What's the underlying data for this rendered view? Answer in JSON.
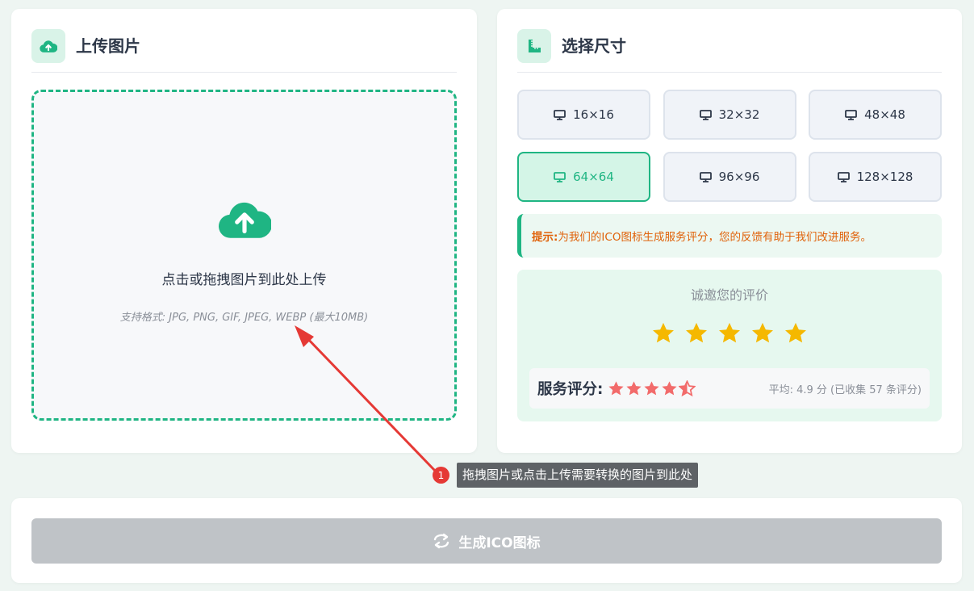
{
  "upload": {
    "title": "上传图片",
    "dropzone_text": "点击或拖拽图片到此处上传",
    "formats_text": "支持格式: JPG, PNG, GIF, JPEG, WEBP (最大10MB)"
  },
  "sizes": {
    "title": "选择尺寸",
    "options": [
      {
        "label": "16×16",
        "selected": false
      },
      {
        "label": "32×32",
        "selected": false
      },
      {
        "label": "48×48",
        "selected": false
      },
      {
        "label": "64×64",
        "selected": true
      },
      {
        "label": "96×96",
        "selected": false
      },
      {
        "label": "128×128",
        "selected": false
      }
    ]
  },
  "tip": {
    "prefix": "提示:",
    "text": "为我们的ICO图标生成服务评分，您的反馈有助于我们改进服务。"
  },
  "rating": {
    "invite": "诚邀您的评价",
    "star_count": 5,
    "score_label": "服务评分:",
    "average_stars": 4.5,
    "summary": "平均: 4.9 分 (已收集 57 条评分)"
  },
  "action": {
    "generate_label": "生成ICO图标"
  },
  "annotation": {
    "number": "1",
    "text": "拖拽图片或点击上传需要转换的图片到此处"
  },
  "colors": {
    "accent": "#1fb583",
    "tip_text": "#e0620a",
    "star_yellow": "#f5b800",
    "star_red": "#f26b6b",
    "button_disabled": "#bfc3c7",
    "annotation_red": "#e53935"
  },
  "icons": {
    "upload_header": "cloud-upload-icon",
    "size_header": "ruler-icon",
    "size_option": "monitor-icon",
    "generate": "sync-icon"
  }
}
